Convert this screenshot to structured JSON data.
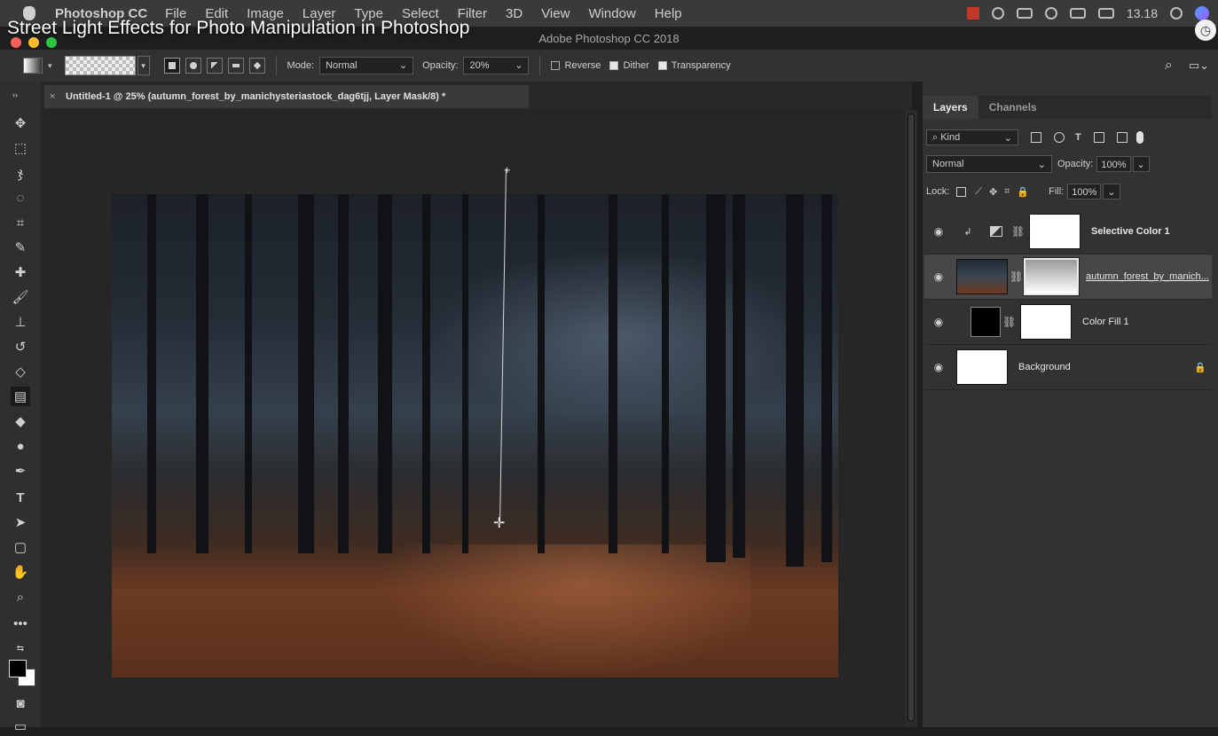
{
  "menubar": {
    "app": "Photoshop CC",
    "items": [
      "File",
      "Edit",
      "Image",
      "Layer",
      "Type",
      "Select",
      "Filter",
      "3D",
      "View",
      "Window",
      "Help"
    ],
    "time": "13.18"
  },
  "video": {
    "title": "Street Light Effects for Photo Manipulation in Photoshop"
  },
  "window": {
    "title": "Adobe Photoshop CC 2018"
  },
  "options": {
    "mode_label": "Mode:",
    "mode_value": "Normal",
    "opacity_label": "Opacity:",
    "opacity_value": "20%",
    "reverse_label": "Reverse",
    "reverse_checked": false,
    "dither_label": "Dither",
    "dither_checked": true,
    "transparency_label": "Transparency",
    "transparency_checked": true
  },
  "document": {
    "tab": "Untitled-1 @ 25% (autumn_forest_by_manichysteriastock_dag6tjj, Layer Mask/8) *",
    "close": "×"
  },
  "layers_panel": {
    "tabs": [
      "Layers",
      "Channels"
    ],
    "kind_label": "Kind",
    "blend_mode": "Normal",
    "opacity_label": "Opacity:",
    "opacity_value": "100%",
    "lock_label": "Lock:",
    "fill_label": "Fill:",
    "fill_value": "100%",
    "layers": [
      {
        "name": "Selective Color 1"
      },
      {
        "name": "autumn_forest_by_manich..."
      },
      {
        "name": "Color Fill 1"
      },
      {
        "name": "Background"
      }
    ]
  },
  "colors": {
    "foreground": "#000000",
    "background": "#ffffff",
    "accent_panel": "#474747"
  }
}
